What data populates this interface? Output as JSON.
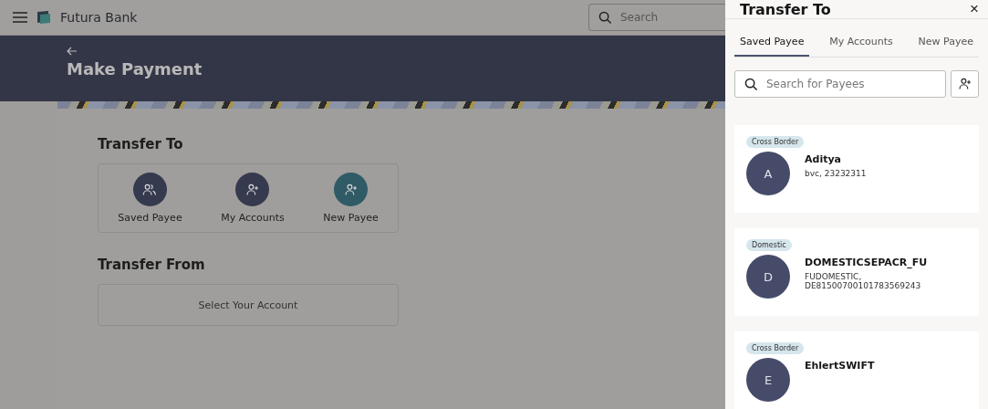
{
  "header": {
    "brand": "Futura Bank",
    "search": {
      "placeholder": "Search"
    }
  },
  "page": {
    "title": "Make Payment"
  },
  "transfer_to": {
    "heading": "Transfer To",
    "options": [
      {
        "label": "Saved Payee",
        "kind": "group",
        "color": "#363a4e"
      },
      {
        "label": "My Accounts",
        "kind": "add_person",
        "color": "#363a4e"
      },
      {
        "label": "New Payee",
        "kind": "add_person",
        "color": "#2f5a66"
      }
    ]
  },
  "transfer_from": {
    "heading": "Transfer From",
    "placeholder": "Select Your Account"
  },
  "drawer": {
    "title": "Transfer To",
    "close": "×",
    "tabs": [
      {
        "label": "Saved Payee",
        "selected": true
      },
      {
        "label": "My Accounts",
        "selected": false
      },
      {
        "label": "New Payee",
        "selected": false
      }
    ],
    "search": {
      "placeholder": "Search for Payees"
    },
    "payees": [
      {
        "tag": "Cross Border",
        "initial": "A",
        "name": "Aditya",
        "detail": "bvc, 23232311"
      },
      {
        "tag": "Domestic",
        "initial": "D",
        "name": "DOMESTICSEPACR_FU",
        "detail": "FUDOMESTIC, DE81500700101783569243"
      },
      {
        "tag": "Cross Border",
        "initial": "E",
        "name": "EhlertSWIFT"
      }
    ]
  }
}
